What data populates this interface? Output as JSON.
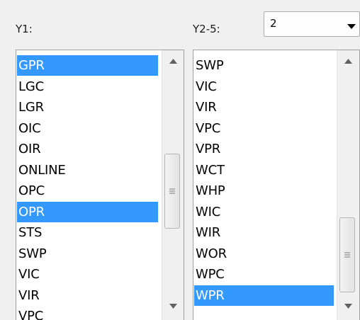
{
  "labels": {
    "y1": "Y1:",
    "y2_5": "Y2-5:"
  },
  "combo": {
    "selected": "2",
    "icon": "chevron-down-icon"
  },
  "y1_list": {
    "items": [
      "GPR",
      "LGC",
      "LGR",
      "OIC",
      "OIR",
      "ONLINE",
      "OPC",
      "OPR",
      "STS",
      "SWP",
      "VIC",
      "VIR",
      "VPC"
    ],
    "selected": [
      "GPR",
      "OPR"
    ],
    "scroll_position": 0.55
  },
  "y2_5_list": {
    "items": [
      "SWP",
      "VIC",
      "VIR",
      "VPC",
      "VPR",
      "WCT",
      "WHP",
      "WIC",
      "WIR",
      "WOR",
      "WPC",
      "WPR"
    ],
    "selected": [
      "WPR"
    ],
    "scroll_position": 1.0
  },
  "colors": {
    "selection": "#3399ff",
    "background": "#f0f0f0",
    "list_background": "#ffffff"
  },
  "icons": {
    "scroll_up": "chevron-up-icon",
    "scroll_down": "chevron-down-icon",
    "thumb_grip": "grip-icon"
  }
}
